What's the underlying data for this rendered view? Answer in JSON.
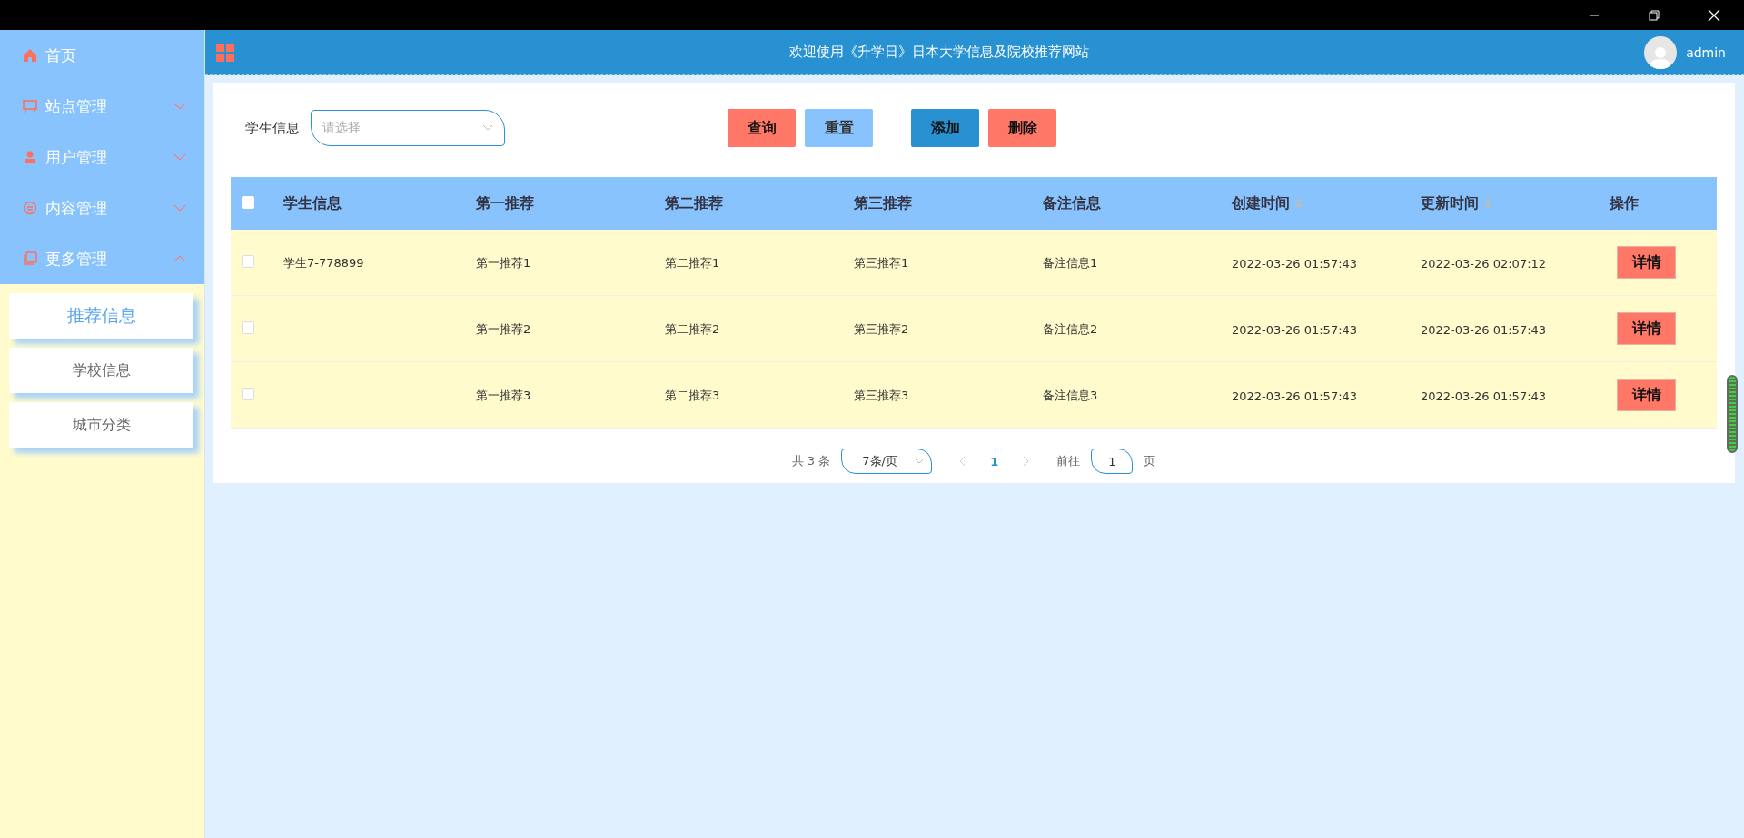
{
  "header": {
    "title": "欢迎使用《升学日》日本大学信息及院校推荐网站",
    "user": "admin"
  },
  "sidebar": {
    "items": [
      {
        "kind": "home",
        "label": "首页"
      },
      {
        "kind": "site",
        "label": "站点管理",
        "expanded": false
      },
      {
        "kind": "user",
        "label": "用户管理",
        "expanded": false
      },
      {
        "kind": "content",
        "label": "内容管理",
        "expanded": false
      },
      {
        "kind": "more",
        "label": "更多管理",
        "expanded": true,
        "children": [
          {
            "label": "推荐信息",
            "selected": true
          },
          {
            "label": "学校信息",
            "selected": false
          },
          {
            "label": "城市分类",
            "selected": false
          }
        ]
      }
    ]
  },
  "filter": {
    "label": "学生信息",
    "placeholder": "请选择"
  },
  "buttons": [
    {
      "kind": "danger",
      "label": "查询"
    },
    {
      "kind": "light",
      "label": "重置"
    },
    {
      "kind": "primary",
      "label": "添加"
    },
    {
      "kind": "danger",
      "label": "删除"
    }
  ],
  "table": {
    "all_checked": false,
    "columns": [
      {
        "label": "学生信息",
        "sortable": false
      },
      {
        "label": "第一推荐",
        "sortable": false
      },
      {
        "label": "第二推荐",
        "sortable": false
      },
      {
        "label": "第三推荐",
        "sortable": false
      },
      {
        "label": "备注信息",
        "sortable": false
      },
      {
        "label": "创建时间",
        "sortable": true
      },
      {
        "label": "更新时间",
        "sortable": true
      },
      {
        "label": "操作",
        "sortable": false
      }
    ],
    "rows": [
      {
        "checked": false,
        "cells": [
          "学生7-778899",
          "第一推荐1",
          "第二推荐1",
          "第三推荐1",
          "备注信息1",
          "2022-03-26 01:57:43",
          "2022-03-26 02:07:12"
        ],
        "action": "详情"
      },
      {
        "checked": false,
        "cells": [
          "",
          "第一推荐2",
          "第二推荐2",
          "第三推荐2",
          "备注信息2",
          "2022-03-26 01:57:43",
          "2022-03-26 01:57:43"
        ],
        "action": "详情"
      },
      {
        "checked": false,
        "cells": [
          "",
          "第一推荐3",
          "第二推荐3",
          "第三推荐3",
          "备注信息3",
          "2022-03-26 01:57:43",
          "2022-03-26 01:57:43"
        ],
        "action": "详情"
      }
    ]
  },
  "pagination": {
    "total": "共 3 条",
    "page_size": "7条/页",
    "pages": [
      {
        "label": "1",
        "selected": true
      }
    ],
    "goto_label": "前往",
    "goto_value": "1",
    "goto_suffix": "页"
  }
}
